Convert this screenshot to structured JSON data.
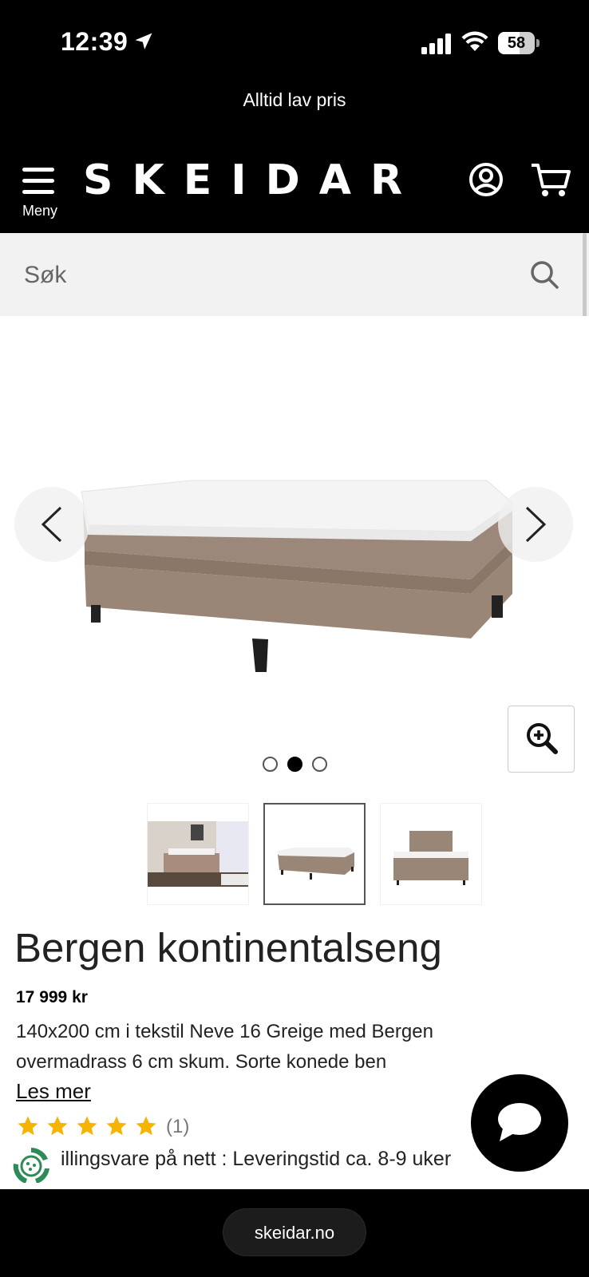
{
  "status_bar": {
    "time": "12:39",
    "battery": "58",
    "battery_level": 0.58
  },
  "promo": {
    "text": "Alltid lav pris"
  },
  "header": {
    "menu_label": "Meny",
    "logo": "SKEIDAR"
  },
  "search": {
    "placeholder": "Søk"
  },
  "gallery": {
    "slide_count": 3,
    "active_slide": 2,
    "thumbnails": [
      "bedroom-scene",
      "bed-angled",
      "bed-front"
    ]
  },
  "product": {
    "title": "Bergen kontinentalseng",
    "price": "17 999 kr",
    "description": "140x200 cm i tekstil Neve 16 Greige med Bergen overmadrass 6 cm skum. Sorte konede ben",
    "read_more": "Les mer",
    "rating_stars": 5,
    "rating_count": "(1)",
    "stock_text": "illingsvare på nett : Leveringstid ca. 8-9 uker"
  },
  "browser": {
    "url": "skeidar.no"
  },
  "colors": {
    "header_bg": "#000000",
    "search_bg": "#f2f2f2",
    "star": "#f5b400",
    "eco": "#2e8b57"
  }
}
